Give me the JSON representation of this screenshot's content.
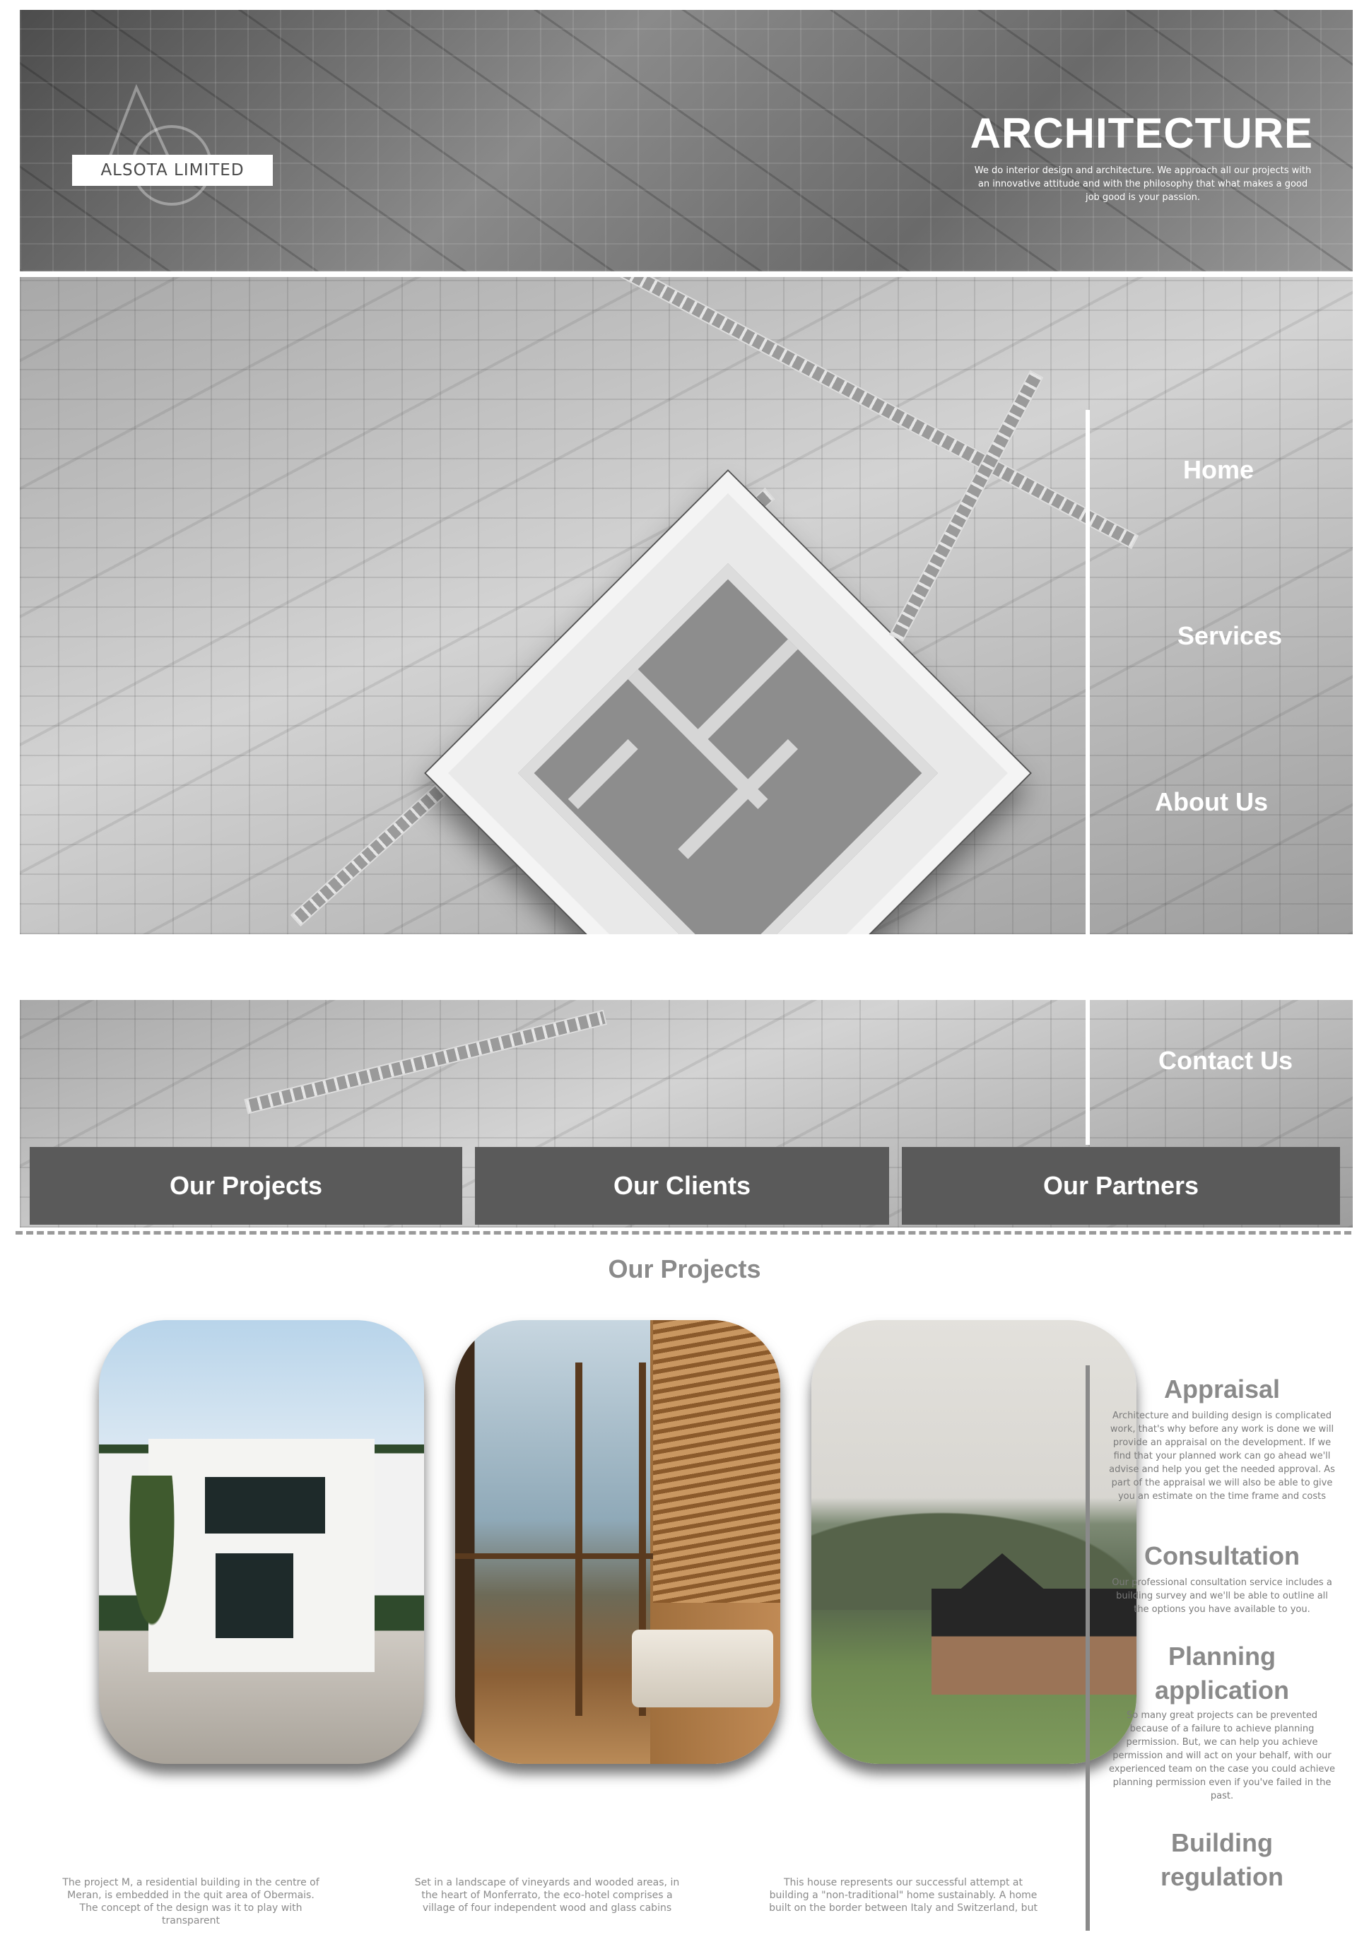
{
  "header": {
    "logo_label": "ALSOTA LIMITED",
    "title": "ARCHITECTURE",
    "subtitle": "We do interior design and architecture. We approach all our projects with an innovative attitude and with the philosophy that what makes a good job good is your passion."
  },
  "nav": {
    "home": "Home",
    "services": "Services",
    "about": "About Us",
    "contact": "Contact Us"
  },
  "tabs": {
    "projects": "Our Projects",
    "clients": "Our Clients",
    "partners": "Our Partners"
  },
  "projects": {
    "title": "Our Projects",
    "captions": [
      "The project M, a residential building in the centre of Meran, is embedded in the quit area of Obermais. The concept of the design was it to play with transparent",
      "Set in a landscape of vineyards and wooded areas, in the heart of Monferrato, the eco-hotel comprises a village of four independent wood and glass cabins",
      "This house represents our successful attempt at building a \"non-traditional\" home sustainably. A home built on the border between Italy and Switzerland, but"
    ]
  },
  "services": [
    {
      "title": "Appraisal",
      "text": "Architecture and building design is complicated work, that's why before any work is done we will provide an appraisal on the development. If we find that your planned work can go ahead we'll advise and help you get the needed approval. As part of the appraisal we will also be able to give you an estimate on the time frame and costs"
    },
    {
      "title": "Consultation",
      "text": "Our professional consultation service includes a building survey and we'll be able to outline all the options you have available to you."
    },
    {
      "title": "Planning application",
      "text": "So many great projects can be prevented because of a failure to achieve planning permission. But, we can help you achieve permission and will act on your behalf, with our experienced team on the case you could achieve planning permission even if you've failed in the past."
    },
    {
      "title": "Building regulation",
      "text": ""
    }
  ]
}
